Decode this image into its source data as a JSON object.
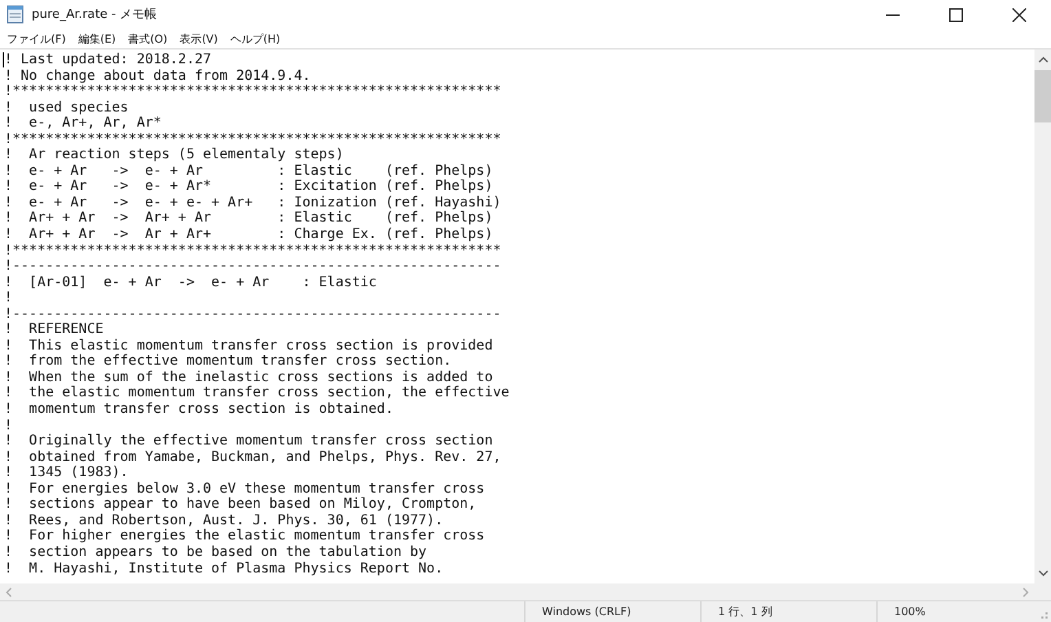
{
  "window": {
    "title": "pure_Ar.rate - メモ帳"
  },
  "menu": [
    "ファイル(F)",
    "編集(E)",
    "書式(O)",
    "表示(V)",
    "ヘルプ(H)"
  ],
  "document": {
    "lines": [
      "! Last updated: 2018.2.27",
      "! No change about data from 2014.9.4.",
      "!***********************************************************",
      "!  used species",
      "!  e-, Ar+, Ar, Ar*",
      "!***********************************************************",
      "!  Ar reaction steps (5 elementaly steps)",
      "!  e- + Ar   ->  e- + Ar         : Elastic    (ref. Phelps)",
      "!  e- + Ar   ->  e- + Ar*        : Excitation (ref. Phelps)",
      "!  e- + Ar   ->  e- + e- + Ar+   : Ionization (ref. Hayashi)",
      "!  Ar+ + Ar  ->  Ar+ + Ar        : Elastic    (ref. Phelps)",
      "!  Ar+ + Ar  ->  Ar + Ar+        : Charge Ex. (ref. Phelps)",
      "!***********************************************************",
      "!-----------------------------------------------------------",
      "!  [Ar-01]  e- + Ar  ->  e- + Ar    : Elastic",
      "!",
      "!-----------------------------------------------------------",
      "!  REFERENCE",
      "!  This elastic momentum transfer cross section is provided",
      "!  from the effective momentum transfer cross section.",
      "!  When the sum of the inelastic cross sections is added to",
      "!  the elastic momentum transfer cross section, the effective",
      "!  momentum transfer cross section is obtained.",
      "!",
      "!  Originally the effective momentum transfer cross section",
      "!  obtained from Yamabe, Buckman, and Phelps, Phys. Rev. 27,",
      "!  1345 (1983).",
      "!  For energies below 3.0 eV these momentum transfer cross",
      "!  sections appear to have been based on Miloy, Crompton,",
      "!  Rees, and Robertson, Aust. J. Phys. 30, 61 (1977).",
      "!  For higher energies the elastic momentum transfer cross",
      "!  section appears to be based on the tabulation by",
      "!  M. Hayashi, Institute of Plasma Physics Report No."
    ]
  },
  "status_bar": {
    "line_ending": "Windows (CRLF)",
    "position": "1 行、1 列",
    "zoom": "100%"
  }
}
